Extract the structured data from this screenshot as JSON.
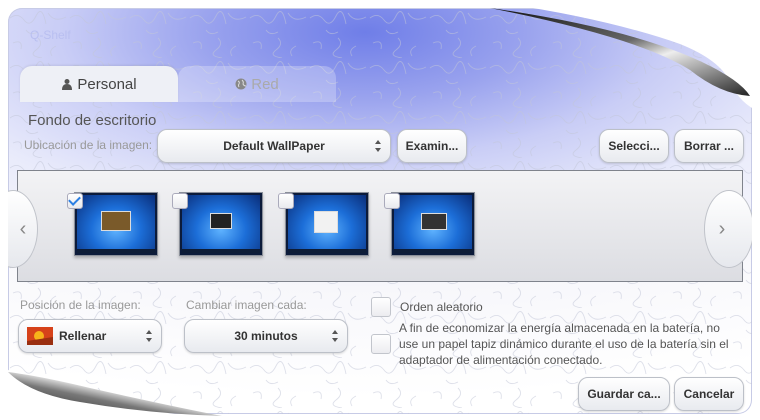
{
  "window": {
    "title": "Q-Shelf"
  },
  "tabs": [
    {
      "label": "Personal",
      "icon": "person-icon",
      "active": true
    },
    {
      "label": "Red",
      "icon": "globe-icon",
      "active": false
    }
  ],
  "section": {
    "title": "Fondo de escritorio"
  },
  "location": {
    "label": "Ubicación de la imagen:",
    "value": "Default WallPaper",
    "browse_label": "Examin...",
    "select_label": "Selecci...",
    "clear_label": "Borrar ..."
  },
  "gallery": {
    "items": [
      {
        "checked": true
      },
      {
        "checked": false
      },
      {
        "checked": false
      },
      {
        "checked": false
      }
    ]
  },
  "position": {
    "label": "Posición de la imagen:",
    "value": "Rellenar"
  },
  "interval": {
    "label": "Cambiar imagen cada:",
    "value": "30 minutos"
  },
  "random": {
    "label": "Orden aleatorio"
  },
  "battery": {
    "text": "A fin de economizar la energía almacenada en la batería, no use un papel tapiz dinámico durante el uso de la batería sin el adaptador de alimentación conectado."
  },
  "footer": {
    "save_label": "Guardar ca...",
    "cancel_label": "Cancelar"
  },
  "colors": {
    "accent": "#2c7fe3",
    "header_gradient": "#6f7ee8"
  }
}
